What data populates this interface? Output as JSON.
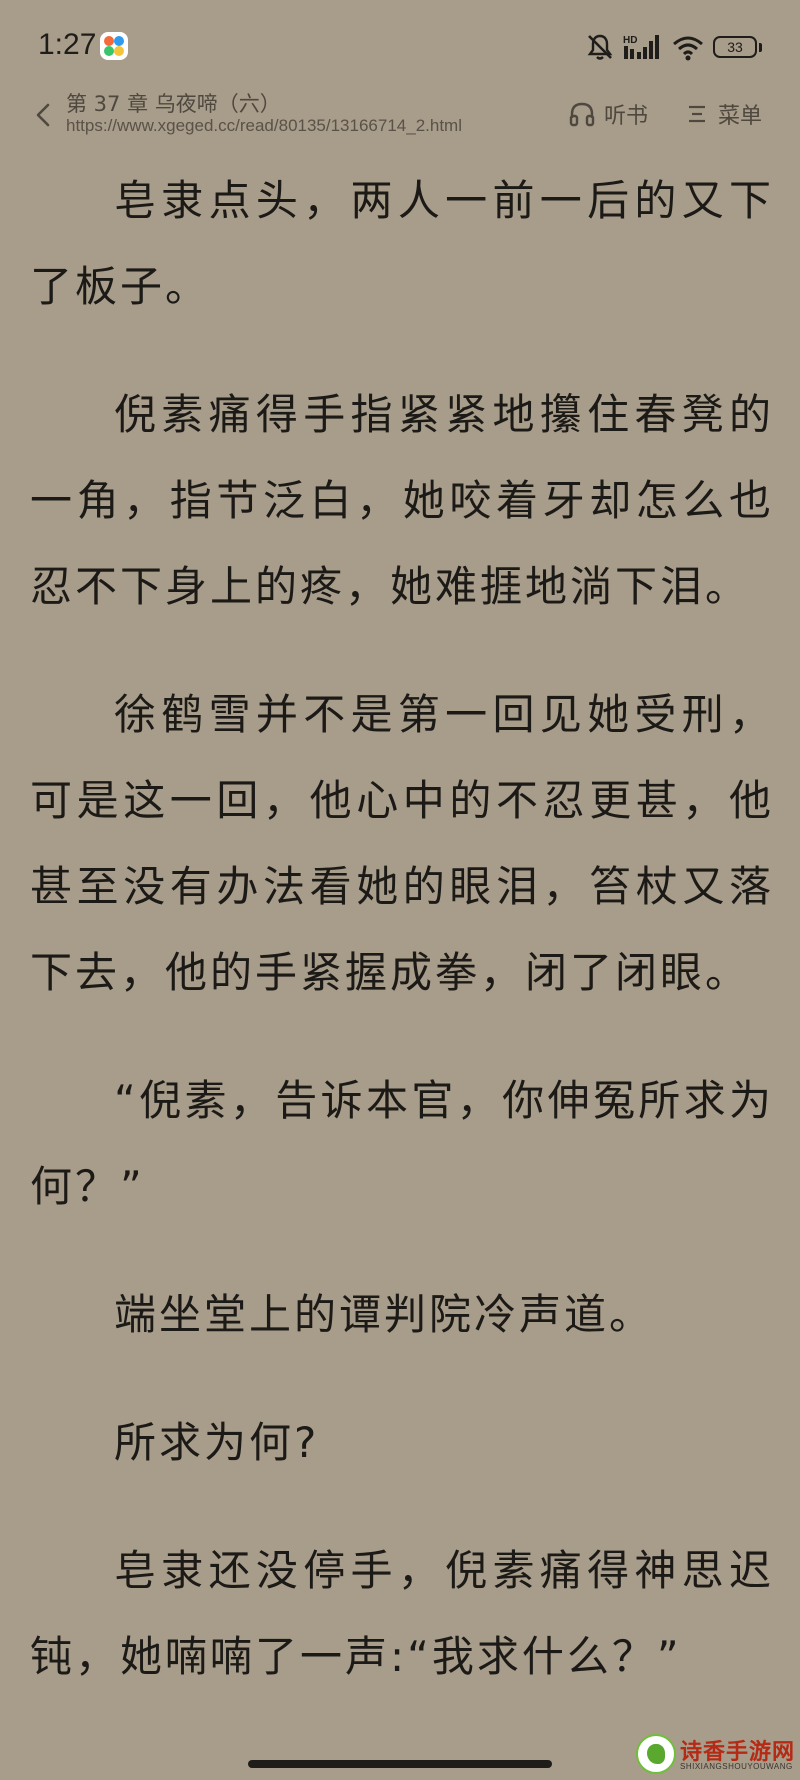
{
  "status_bar": {
    "time": "1:27",
    "network_label": "HD",
    "battery_level": "33"
  },
  "header": {
    "chapter_title": "第 37 章 乌夜啼（六）",
    "url": "https://www.xgeged.cc/read/80135/13166714_2.html",
    "listen_label": "听书",
    "menu_label": "菜单"
  },
  "content": {
    "paragraphs": [
      "皂隶点头，两人一前一后的又下了板子。",
      "倪素痛得手指紧紧地攥住春凳的一角，指节泛白，她咬着牙却怎么也忍不下身上的疼，她难捱地淌下泪。",
      "徐鹤雪并不是第一回见她受刑，可是这一回，他心中的不忍更甚，他甚至没有办法看她的眼泪，笞杖又落下去，他的手紧握成拳，闭了闭眼。",
      "“倪素，告诉本官，你伸冤所求为何？”",
      "端坐堂上的谭判院冷声道。",
      "所求为何?",
      "皂隶还没停手，倪素痛得神思迟钝，她喃喃了一声:“我求什么？”"
    ]
  },
  "watermark": {
    "title": "诗香手游网",
    "subtitle": "SHIXIANGSHOUYOUWANG"
  },
  "colors": {
    "background": "#a89c8a",
    "text": "#1c1a17",
    "header_text": "#4f483f"
  }
}
